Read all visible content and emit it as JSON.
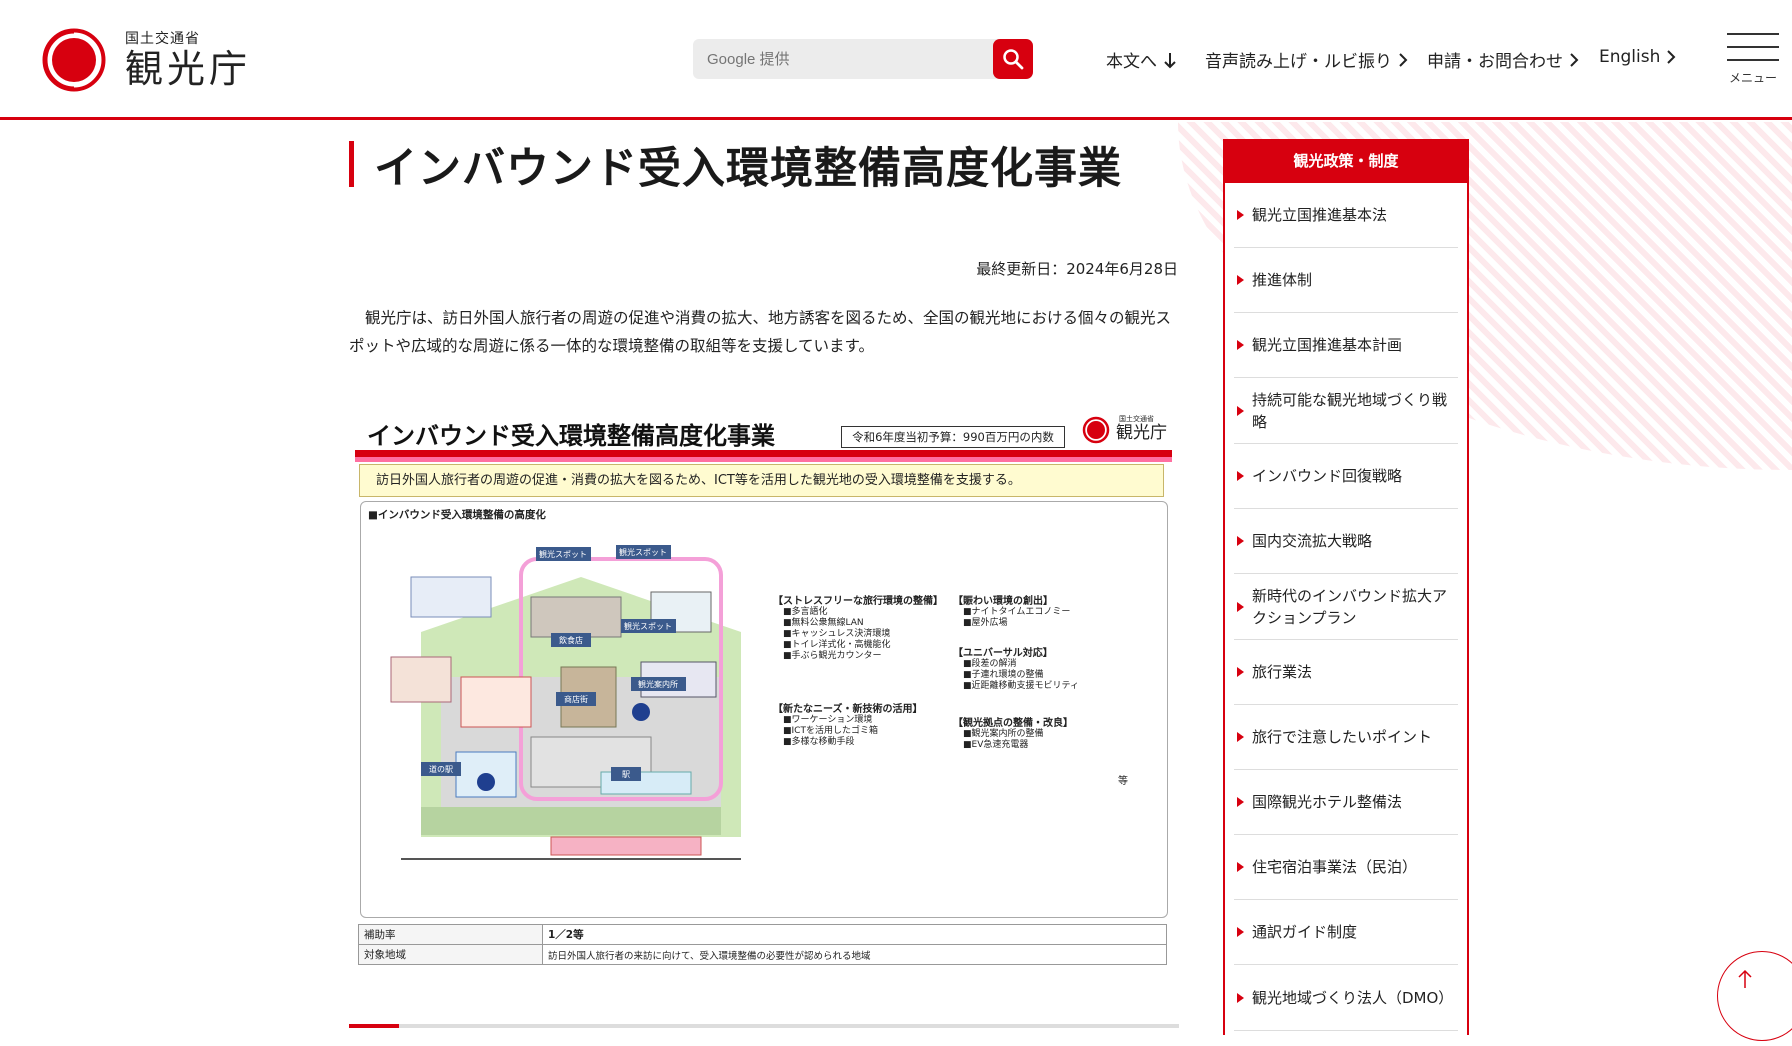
{
  "header": {
    "logo_sub": "国土交通省",
    "logo_main": "観光庁",
    "search_placeholder": "Google 提供",
    "nav": [
      {
        "label": "本文へ"
      },
      {
        "label": "音声読み上げ・ルビ振り"
      },
      {
        "label": "申請・お問合わせ"
      },
      {
        "label": "English"
      }
    ],
    "menu_label": "メニュー"
  },
  "main": {
    "title": "インバウンド受入環境整備高度化事業",
    "updated": "最終更新日：2024年6月28日",
    "intro": "観光庁は、訪日外国人旅行者の周遊の促進や消費の拡大、地方誘客を図るため、全国の観光地における個々の観光スポットや広域的な周遊に係る一体的な環境整備の取組等を支援しています。"
  },
  "figure": {
    "title": "インバウンド受入環境整備高度化事業",
    "budget": "令和6年度当初予算：990百万円の内数",
    "logo_sub": "国土交通省",
    "logo_main": "観光庁",
    "lead": "訪日外国人旅行者の周遊の促進・消費の拡大を図るため、ICT等を活用した観光地の受入環境整備を支援する。",
    "box_heading": "■インバウンド受入環境整備の高度化",
    "illus_labels": [
      "観光スポット",
      "観光スポット",
      "観光スポット",
      "飲食店",
      "商店街",
      "観光案内所",
      "道の駅",
      "駅"
    ],
    "categories": [
      {
        "name": "【ストレスフリーな旅行環境の整備】",
        "items": [
          "■多言語化",
          "■無料公衆無線LAN",
          "■キャッシュレス決済環境",
          "■トイレ洋式化・高機能化",
          "■手ぶら観光カウンター"
        ]
      },
      {
        "name": "【新たなニーズ・新技術の活用】",
        "items": [
          "■ワーケーション環境",
          "■ICTを活用したゴミ箱",
          "■多様な移動手段"
        ]
      },
      {
        "name": "【賑わい環境の創出】",
        "items": [
          "■ナイトタイムエコノミー",
          "■屋外広場"
        ]
      },
      {
        "name": "【ユニバーサル対応】",
        "items": [
          "■段差の解消",
          "■子連れ環境の整備",
          "■近距離移動支援モビリティ"
        ]
      },
      {
        "name": "【観光拠点の整備・改良】",
        "items": [
          "■観光案内所の整備",
          "■EV急速充電器"
        ]
      }
    ],
    "etc": "等",
    "table": [
      {
        "k": "補助率",
        "v": "1／2等"
      },
      {
        "k": "対象地域",
        "v": "訪日外国人旅行者の来訪に向けて、受入環境整備の必要性が認められる地域"
      }
    ]
  },
  "sidebar": {
    "heading": "観光政策・制度",
    "items": [
      {
        "label": "観光立国推進基本法"
      },
      {
        "label": "推進体制"
      },
      {
        "label": "観光立国推進基本計画"
      },
      {
        "label": "持続可能な観光地域づくり戦略"
      },
      {
        "label": "インバウンド回復戦略"
      },
      {
        "label": "国内交流拡大戦略"
      },
      {
        "label": "新時代のインバウンド拡大アクションプラン"
      },
      {
        "label": "旅行業法"
      },
      {
        "label": "旅行で注意したいポイント"
      },
      {
        "label": "国際観光ホテル整備法"
      },
      {
        "label": "住宅宿泊事業法（民泊）"
      },
      {
        "label": "通訳ガイド制度"
      },
      {
        "label": "観光地域づくり法人（DMO）"
      }
    ]
  },
  "colors": {
    "accent": "#d7000f",
    "pink": "#ff6fa0",
    "lead_bg": "#fffbd0"
  },
  "icons": [
    "search-icon",
    "arrow-down-icon",
    "chevron-right-icon",
    "hamburger-icon",
    "arrow-up-icon"
  ]
}
